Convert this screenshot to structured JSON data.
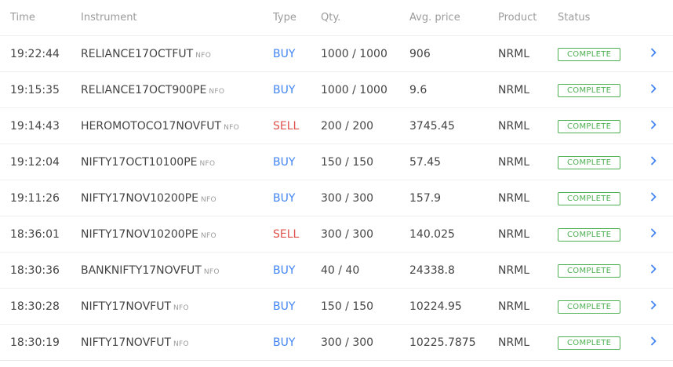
{
  "columns": {
    "time": "Time",
    "instrument": "Instrument",
    "type": "Type",
    "qty": "Qty.",
    "avg_price": "Avg. price",
    "product": "Product",
    "status": "Status"
  },
  "colors": {
    "buy": "#4184f3",
    "sell": "#df514c",
    "status_complete": "#4caf50",
    "chevron": "#4184f3"
  },
  "icons": {
    "row_action": "chevron-right-icon"
  },
  "orders": [
    {
      "time": "19:22:44",
      "instrument": "RELIANCE17OCTFUT",
      "exchange": "NFO",
      "type": "BUY",
      "qty": "1000 / 1000",
      "avg_price": "906",
      "product": "NRML",
      "status": "COMPLETE"
    },
    {
      "time": "19:15:35",
      "instrument": "RELIANCE17OCT900PE",
      "exchange": "NFO",
      "type": "BUY",
      "qty": "1000 / 1000",
      "avg_price": "9.6",
      "product": "NRML",
      "status": "COMPLETE"
    },
    {
      "time": "19:14:43",
      "instrument": "HEROMOTOCO17NOVFUT",
      "exchange": "NFO",
      "type": "SELL",
      "qty": "200 / 200",
      "avg_price": "3745.45",
      "product": "NRML",
      "status": "COMPLETE"
    },
    {
      "time": "19:12:04",
      "instrument": "NIFTY17OCT10100PE",
      "exchange": "NFO",
      "type": "BUY",
      "qty": "150 / 150",
      "avg_price": "57.45",
      "product": "NRML",
      "status": "COMPLETE"
    },
    {
      "time": "19:11:26",
      "instrument": "NIFTY17NOV10200PE",
      "exchange": "NFO",
      "type": "BUY",
      "qty": "300 / 300",
      "avg_price": "157.9",
      "product": "NRML",
      "status": "COMPLETE"
    },
    {
      "time": "18:36:01",
      "instrument": "NIFTY17NOV10200PE",
      "exchange": "NFO",
      "type": "SELL",
      "qty": "300 / 300",
      "avg_price": "140.025",
      "product": "NRML",
      "status": "COMPLETE"
    },
    {
      "time": "18:30:36",
      "instrument": "BANKNIFTY17NOVFUT",
      "exchange": "NFO",
      "type": "BUY",
      "qty": "40 / 40",
      "avg_price": "24338.8",
      "product": "NRML",
      "status": "COMPLETE"
    },
    {
      "time": "18:30:28",
      "instrument": "NIFTY17NOVFUT",
      "exchange": "NFO",
      "type": "BUY",
      "qty": "150 / 150",
      "avg_price": "10224.95",
      "product": "NRML",
      "status": "COMPLETE"
    },
    {
      "time": "18:30:19",
      "instrument": "NIFTY17NOVFUT",
      "exchange": "NFO",
      "type": "BUY",
      "qty": "300 / 300",
      "avg_price": "10225.7875",
      "product": "NRML",
      "status": "COMPLETE"
    }
  ]
}
